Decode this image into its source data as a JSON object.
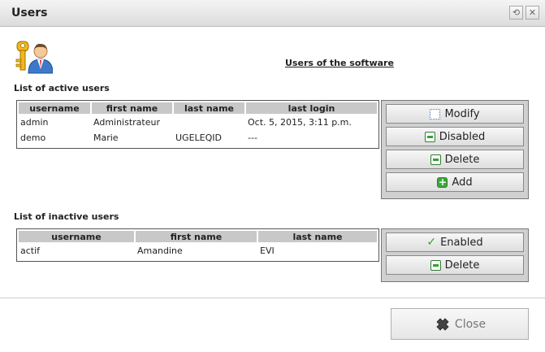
{
  "window": {
    "title": "Users"
  },
  "header": {
    "title": "Users of the software"
  },
  "active": {
    "label": "List of active users",
    "columns": [
      "username",
      "first name",
      "last name",
      "last login"
    ],
    "rows": [
      [
        "admin",
        "Administrateur",
        "",
        "Oct. 5, 2015, 3:11 p.m."
      ],
      [
        "demo",
        "Marie",
        "UGELEQID",
        "---"
      ]
    ],
    "buttons": {
      "modify": "Modify",
      "disabled": "Disabled",
      "delete": "Delete",
      "add": "Add"
    }
  },
  "inactive": {
    "label": "List of inactive users",
    "columns": [
      "username",
      "first name",
      "last name"
    ],
    "rows": [
      [
        "actif",
        "Amandine",
        "EVI"
      ]
    ],
    "buttons": {
      "enabled": "Enabled",
      "delete": "Delete"
    }
  },
  "footer": {
    "close": "Close"
  },
  "colors": {
    "accent_green": "#2fa32f",
    "header_gray": "#c8c8c8",
    "panel_gray": "#d0d0d0"
  }
}
